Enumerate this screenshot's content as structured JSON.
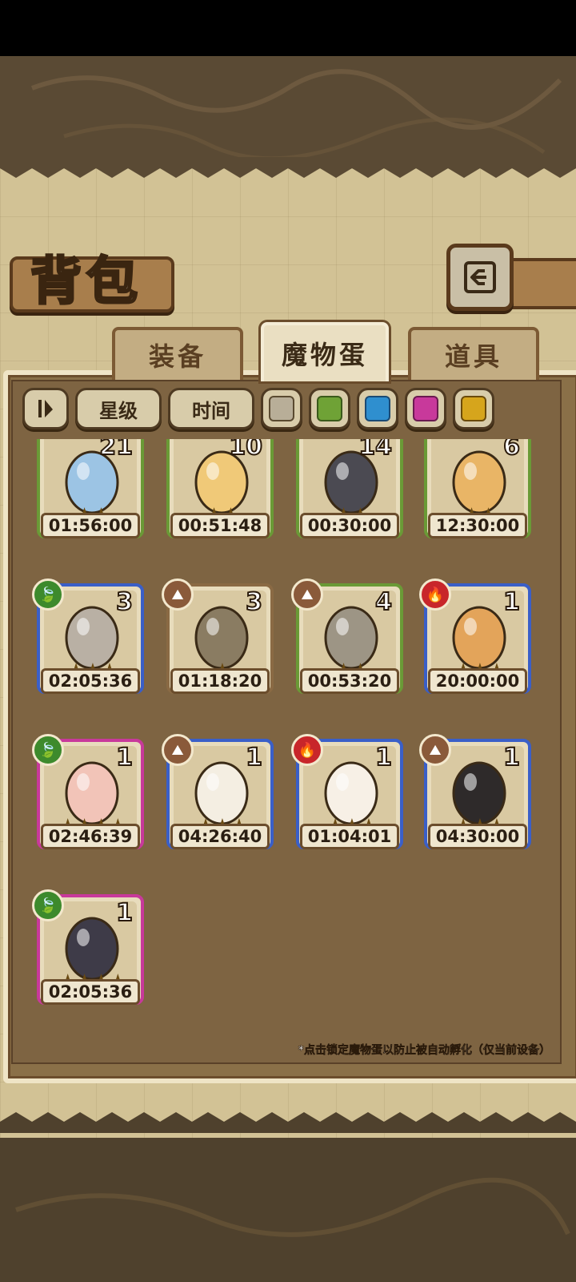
{
  "screen": {
    "title": "背包",
    "tabs": [
      {
        "label": "装备",
        "active": false
      },
      {
        "label": "魔物蛋",
        "active": true
      },
      {
        "label": "道具",
        "active": false
      }
    ],
    "filters": {
      "sort_icon": "sort-toggle-icon",
      "star_label": "星级",
      "time_label": "时间",
      "color_swatches": [
        "#b8ae98",
        "#6fa236",
        "#2f8fcf",
        "#c8399b",
        "#d6a51c"
      ]
    },
    "footnote": "*点击锁定魔物蛋以防止被自动孵化（仅当前设备）"
  },
  "eggs": [
    {
      "count": "21",
      "stars": "★★",
      "timer": "01:56:00",
      "frame": "#6a9a36",
      "element": "water",
      "elem_color": "#2f8fcf",
      "body": "#9cc4e4"
    },
    {
      "count": "10",
      "stars": "★★",
      "timer": "00:51:48",
      "frame": "#6a9a36",
      "element": "earth",
      "elem_color": "#8a5a3a",
      "body": "#f0c978"
    },
    {
      "count": "14",
      "stars": "★★",
      "timer": "00:30:00",
      "frame": "#6a9a36",
      "element": "earth",
      "elem_color": "#8a5a3a",
      "body": "#4b4a52"
    },
    {
      "count": "6",
      "stars": "★★",
      "timer": "12:30:00",
      "frame": "#6a9a36",
      "element": "fire",
      "elem_color": "#c8262a",
      "body": "#e9b566"
    },
    {
      "count": "3",
      "stars": "★★★",
      "timer": "02:05:36",
      "frame": "#3a5fc8",
      "element": "grass",
      "elem_color": "#3d8a2c",
      "body": "#b9b0a4"
    },
    {
      "count": "3",
      "stars": "★",
      "timer": "01:18:20",
      "frame": "#8a6a44",
      "element": "earth",
      "elem_color": "#8a5a3a",
      "body": "#8a7c62"
    },
    {
      "count": "4",
      "stars": "★★",
      "timer": "00:53:20",
      "frame": "#6a9a36",
      "element": "earth",
      "elem_color": "#8a5a3a",
      "body": "#9d9585"
    },
    {
      "count": "1",
      "stars": "★★★",
      "timer": "20:00:00",
      "frame": "#3a5fc8",
      "element": "fire",
      "elem_color": "#c8262a",
      "body": "#e3a45a"
    },
    {
      "count": "1",
      "stars": "★★★★",
      "timer": "02:46:39",
      "frame": "#c8399b",
      "element": "grass",
      "elem_color": "#3d8a2c",
      "body": "#f2c4b8"
    },
    {
      "count": "1",
      "stars": "★★★",
      "timer": "04:26:40",
      "frame": "#3a5fc8",
      "element": "earth",
      "elem_color": "#8a5a3a",
      "body": "#f4eee2"
    },
    {
      "count": "1",
      "stars": "★★★",
      "timer": "01:04:01",
      "frame": "#3a5fc8",
      "element": "fire",
      "elem_color": "#c8262a",
      "body": "#f7f0e6"
    },
    {
      "count": "1",
      "stars": "★★★",
      "timer": "04:30:00",
      "frame": "#3a5fc8",
      "element": "earth",
      "elem_color": "#8a5a3a",
      "body": "#2e2a2a"
    },
    {
      "count": "1",
      "stars": "★★★★",
      "timer": "02:05:36",
      "frame": "#c8399b",
      "element": "grass",
      "elem_color": "#3d8a2c",
      "body": "#3e3b48"
    }
  ]
}
